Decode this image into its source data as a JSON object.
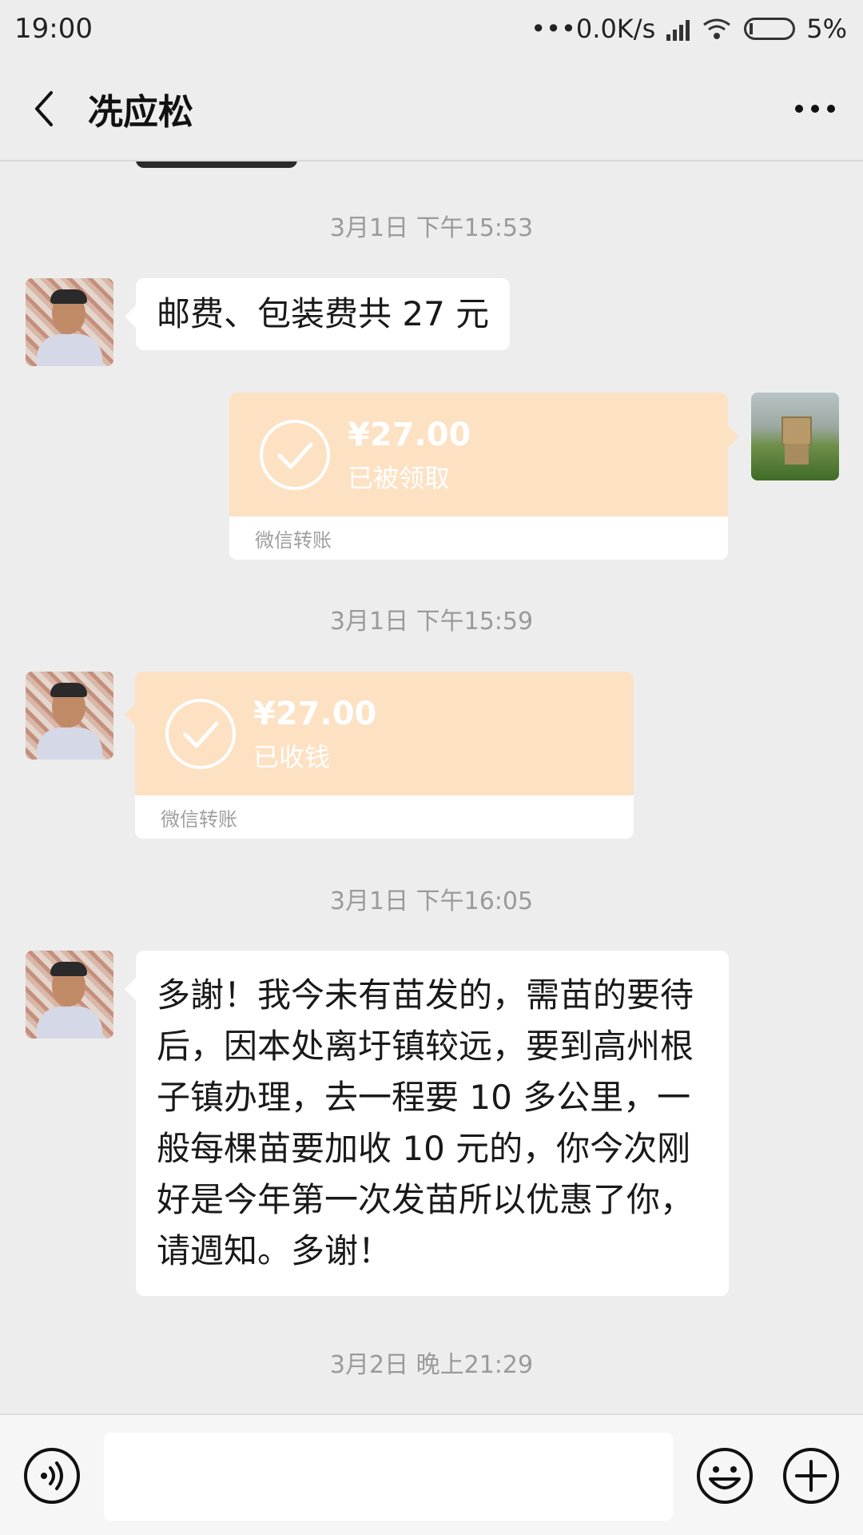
{
  "status_bar": {
    "time": "19:00",
    "network": "•••0.0K/s",
    "battery": "5%"
  },
  "header": {
    "title": "冼应松"
  },
  "messages": {
    "ts1": "3月1日 下午15:53",
    "msg1": "邮费、包装费共 27 元",
    "transfer1": {
      "amount": "¥27.00",
      "status": "已被领取",
      "footer": "微信转账"
    },
    "ts2": "3月1日 下午15:59",
    "transfer2": {
      "amount": "¥27.00",
      "status": "已收钱",
      "footer": "微信转账"
    },
    "ts3": "3月1日 下午16:05",
    "msg3_lines": [
      "多謝！我今未有苗发的，需苗的要待",
      "后，因本处离圩镇较远，要到高州根",
      "子镇办理，去一程要 10 多公里，一",
      "般每棵苗要加收 10 元的，你今次刚",
      "好是今年第一次发苗所以优惠了你，",
      "请週知。多谢！"
    ],
    "ts4": "3月2日 晚上21:29"
  },
  "icons": {
    "back": "chevron-left-icon",
    "more": "more-dots-icon",
    "voice": "voice-icon",
    "emoji": "emoji-icon",
    "plus": "plus-icon",
    "check": "check-circle-icon"
  },
  "colors": {
    "transfer_bg": "#fde1c3",
    "page_bg": "#ededed"
  }
}
